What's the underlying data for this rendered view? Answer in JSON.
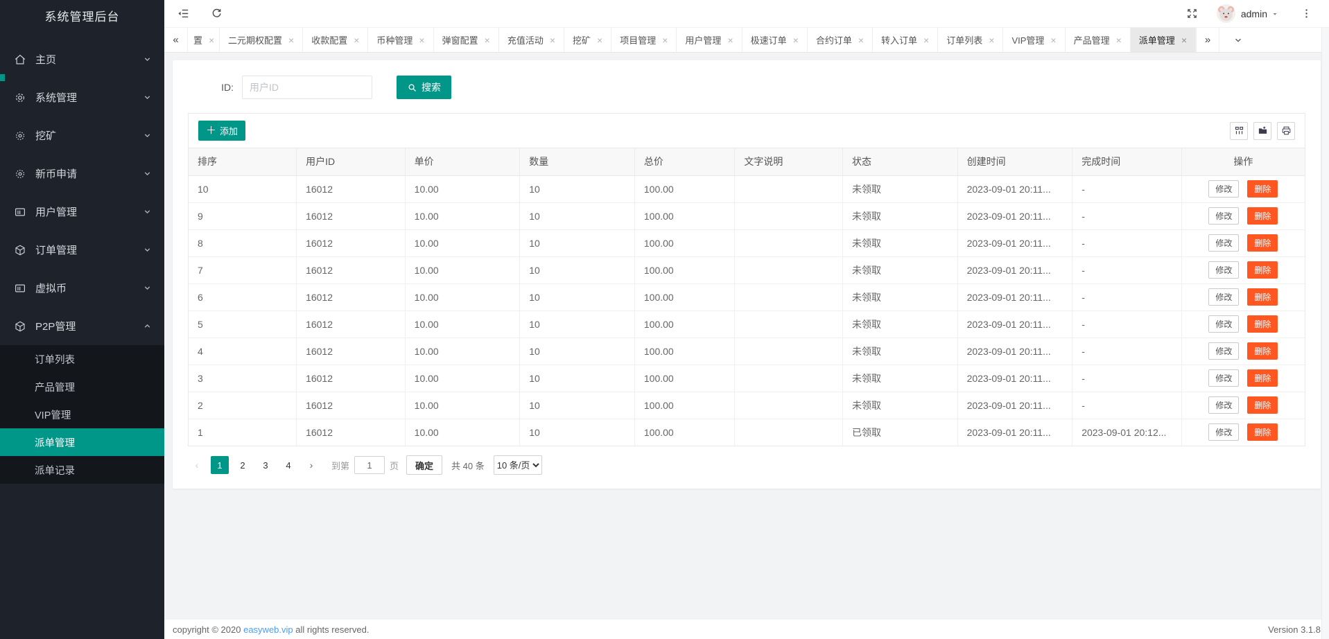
{
  "app": {
    "title": "系统管理后台"
  },
  "colors": {
    "accent": "#009688",
    "danger": "#FF5722",
    "link": "#4a9ef7",
    "sidebar_bg": "#1e222a",
    "submenu_bg": "#13161b",
    "active_tab_bg": "#e9e9e9"
  },
  "header": {
    "username": "admin"
  },
  "sidebar": {
    "items": [
      {
        "label": "主页",
        "icon": "home",
        "expanded": false
      },
      {
        "label": "系统管理",
        "icon": "gear",
        "expanded": false
      },
      {
        "label": "挖矿",
        "icon": "cog",
        "expanded": false
      },
      {
        "label": "新币申请",
        "icon": "cog",
        "expanded": false
      },
      {
        "label": "用户管理",
        "icon": "card",
        "expanded": false
      },
      {
        "label": "订单管理",
        "icon": "cube",
        "expanded": false
      },
      {
        "label": "虚拟币",
        "icon": "card",
        "expanded": false
      },
      {
        "label": "P2P管理",
        "icon": "cube",
        "expanded": true
      }
    ],
    "submenu": {
      "parent": "P2P管理",
      "items": [
        "订单列表",
        "产品管理",
        "VIP管理",
        "派单管理",
        "派单记录"
      ],
      "active": "派单管理"
    }
  },
  "tabs": {
    "truncated_first": "置",
    "items": [
      "二元期权配置",
      "收款配置",
      "币种管理",
      "弹窗配置",
      "充值活动",
      "挖矿",
      "项目管理",
      "用户管理",
      "极速订单",
      "合约订单",
      "转入订单",
      "订单列表",
      "VIP管理",
      "产品管理",
      "派单管理"
    ],
    "active": "派单管理"
  },
  "search": {
    "label": "ID:",
    "placeholder": "用户ID",
    "button": "搜索"
  },
  "toolbar": {
    "add": "添加",
    "tools": [
      "columns",
      "export",
      "print"
    ]
  },
  "table": {
    "headers": [
      "排序",
      "用户ID",
      "单价",
      "数量",
      "总价",
      "文字说明",
      "状态",
      "创建时间",
      "完成时间",
      "操作"
    ],
    "actions": {
      "edit": "修改",
      "delete": "删除"
    },
    "rows": [
      {
        "sort": "10",
        "uid": "16012",
        "price": "10.00",
        "qty": "10",
        "total": "100.00",
        "desc": "",
        "status": "未领取",
        "created": "2023-09-01 20:11...",
        "finished": "-"
      },
      {
        "sort": "9",
        "uid": "16012",
        "price": "10.00",
        "qty": "10",
        "total": "100.00",
        "desc": "",
        "status": "未领取",
        "created": "2023-09-01 20:11...",
        "finished": "-"
      },
      {
        "sort": "8",
        "uid": "16012",
        "price": "10.00",
        "qty": "10",
        "total": "100.00",
        "desc": "",
        "status": "未领取",
        "created": "2023-09-01 20:11...",
        "finished": "-"
      },
      {
        "sort": "7",
        "uid": "16012",
        "price": "10.00",
        "qty": "10",
        "total": "100.00",
        "desc": "",
        "status": "未领取",
        "created": "2023-09-01 20:11...",
        "finished": "-"
      },
      {
        "sort": "6",
        "uid": "16012",
        "price": "10.00",
        "qty": "10",
        "total": "100.00",
        "desc": "",
        "status": "未领取",
        "created": "2023-09-01 20:11...",
        "finished": "-"
      },
      {
        "sort": "5",
        "uid": "16012",
        "price": "10.00",
        "qty": "10",
        "total": "100.00",
        "desc": "",
        "status": "未领取",
        "created": "2023-09-01 20:11...",
        "finished": "-"
      },
      {
        "sort": "4",
        "uid": "16012",
        "price": "10.00",
        "qty": "10",
        "total": "100.00",
        "desc": "",
        "status": "未领取",
        "created": "2023-09-01 20:11...",
        "finished": "-"
      },
      {
        "sort": "3",
        "uid": "16012",
        "price": "10.00",
        "qty": "10",
        "total": "100.00",
        "desc": "",
        "status": "未领取",
        "created": "2023-09-01 20:11...",
        "finished": "-"
      },
      {
        "sort": "2",
        "uid": "16012",
        "price": "10.00",
        "qty": "10",
        "total": "100.00",
        "desc": "",
        "status": "未领取",
        "created": "2023-09-01 20:11...",
        "finished": "-"
      },
      {
        "sort": "1",
        "uid": "16012",
        "price": "10.00",
        "qty": "10",
        "total": "100.00",
        "desc": "",
        "status": "已领取",
        "created": "2023-09-01 20:11...",
        "finished": "2023-09-01 20:12..."
      }
    ]
  },
  "pagination": {
    "pages": [
      "1",
      "2",
      "3",
      "4"
    ],
    "active": "1",
    "goto_label": "到第",
    "goto_value": "1",
    "goto_unit": "页",
    "confirm": "确定",
    "total": "共 40 条",
    "per_page": "10 条/页"
  },
  "footer": {
    "copyright_prefix": "copyright © 2020 ",
    "link": "easyweb.vip",
    "copyright_suffix": " all rights reserved.",
    "version": "Version 3.1.8"
  }
}
